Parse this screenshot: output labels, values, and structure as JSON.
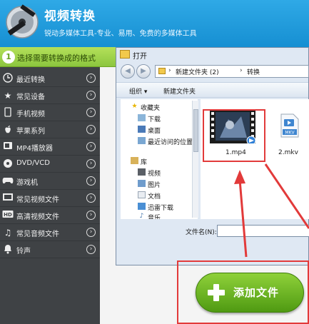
{
  "app": {
    "title": "视频转换",
    "subtitle": "锐动多媒体工具-专业、易用、免费的多媒体工具"
  },
  "step": {
    "number": "1",
    "text": "选择需要转换成的格式"
  },
  "sidebar": {
    "items": [
      {
        "label": "最近转换",
        "icon": "clock-icon"
      },
      {
        "label": "常见设备",
        "icon": "star-icon"
      },
      {
        "label": "手机视频",
        "icon": "phone-icon"
      },
      {
        "label": "苹果系列",
        "icon": "apple-icon"
      },
      {
        "label": "MP4播放器",
        "icon": "mp4-player-icon"
      },
      {
        "label": "DVD/VCD",
        "icon": "disc-icon"
      },
      {
        "label": "游戏机",
        "icon": "gamepad-icon"
      },
      {
        "label": "常见视频文件",
        "icon": "film-icon"
      },
      {
        "label": "高清视频文件",
        "icon": "hd-icon"
      },
      {
        "label": "常见音频文件",
        "icon": "music-icon"
      },
      {
        "label": "铃声",
        "icon": "bell-icon"
      }
    ]
  },
  "dialog": {
    "title": "打开",
    "address": {
      "segments": [
        "新建文件夹 (2)",
        "转换"
      ]
    },
    "toolbar": {
      "organize": "组织 ▾",
      "new_folder": "新建文件夹"
    },
    "nav": {
      "favorites": "收藏夹",
      "downloads": "下载",
      "desktop": "桌面",
      "recent": "最近访问的位置",
      "libraries": "库",
      "videos": "视频",
      "pictures": "图片",
      "documents": "文档",
      "thunder": "迅雷下载",
      "music": "音乐"
    },
    "files": [
      {
        "name": "1.mp4"
      },
      {
        "name": "2.mkv",
        "badge": "MKV"
      }
    ],
    "filename_label": "文件名(N):",
    "filename_value": ""
  },
  "add_button": {
    "label": "添加文件"
  },
  "colors": {
    "header": "#1f9be0",
    "sidebar": "#3f4245",
    "step_green": "#9fd14a",
    "annotation_red": "#e23a3a",
    "add_green": "#5aa817"
  }
}
